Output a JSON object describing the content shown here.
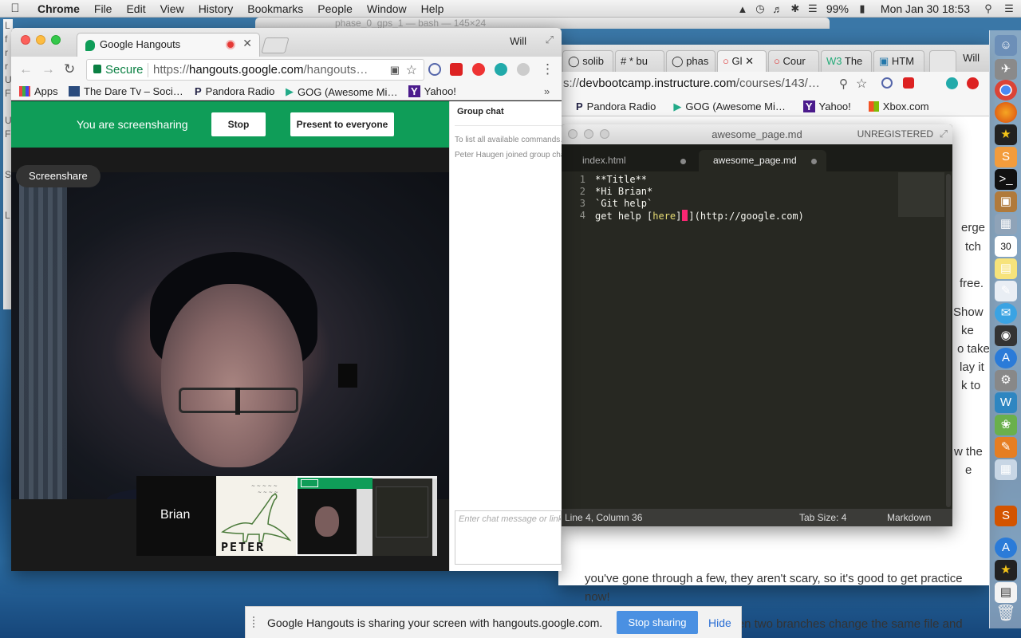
{
  "menubar": {
    "app": "Chrome",
    "items": [
      "File",
      "Edit",
      "View",
      "History",
      "Bookmarks",
      "People",
      "Window",
      "Help"
    ],
    "battery": "99%",
    "clock": "Mon Jan 30  18:53"
  },
  "background_window": {
    "tabs": [
      "solib",
      "* bu",
      "phas",
      "Gl",
      "Cour",
      "The",
      "HTM"
    ],
    "user": "Will",
    "url_prefix": "s://",
    "url_host": "devbootcamp.instructure.com",
    "url_path": "/courses/143/…",
    "bookmarks": [
      "Pandora Radio",
      "GOG (Awesome Mi…",
      "Yahoo!",
      "Xbox.com"
    ],
    "page_fragments": [
      "erge",
      "tch",
      "free.",
      "Show",
      "ke",
      "o take",
      "lay it",
      "k to",
      "w the",
      "e"
    ],
    "page_line1": "you've gone through a few, they aren't scary, so it's good to get practice",
    "page_line2": "now!",
    "page_line3": "A merge conflict happens when two branches change the same file and",
    "behind_title": "phase_0_gps_1 — bash — 145×24"
  },
  "sublime": {
    "title": "awesome_page.md",
    "unregistered": "UNREGISTERED",
    "tabs": [
      "index.html",
      "awesome_page.md"
    ],
    "lines": [
      {
        "n": "1",
        "text": "**Title**"
      },
      {
        "n": "2",
        "text": "*Hi Brian*"
      },
      {
        "n": "3",
        "text": "`Git help`"
      },
      {
        "n": "4",
        "text_before": "get help [",
        "link": "here",
        "text_after": "](http://google.com)"
      }
    ],
    "status": {
      "position": "Line 4, Column 36",
      "tab_size": "Tab Size: 4",
      "syntax": "Markdown"
    }
  },
  "hangouts": {
    "tab_title": "Google Hangouts",
    "user": "Will",
    "secure": "Secure",
    "url_scheme": "https://",
    "url_host": "hangouts.google.com",
    "url_path": "/hangouts…",
    "bookmarks": [
      "Apps",
      "The Dare Tv – Soci…",
      "Pandora Radio",
      "GOG (Awesome Mi…",
      "Yahoo!"
    ],
    "screenshare_msg": "You are screensharing",
    "stop": "Stop",
    "present": "Present to everyone",
    "screenshare_label": "Screenshare",
    "participant": "Brian",
    "chat": {
      "title": "Group chat",
      "line1": "To list all available commands…",
      "line2": "Peter Haugen joined group chat.",
      "placeholder": "Enter chat message or link here"
    },
    "peter_label": "PETER"
  },
  "share_notice": {
    "message": "Google Hangouts is sharing your screen with hangouts.google.com.",
    "stop": "Stop sharing",
    "hide": "Hide"
  }
}
